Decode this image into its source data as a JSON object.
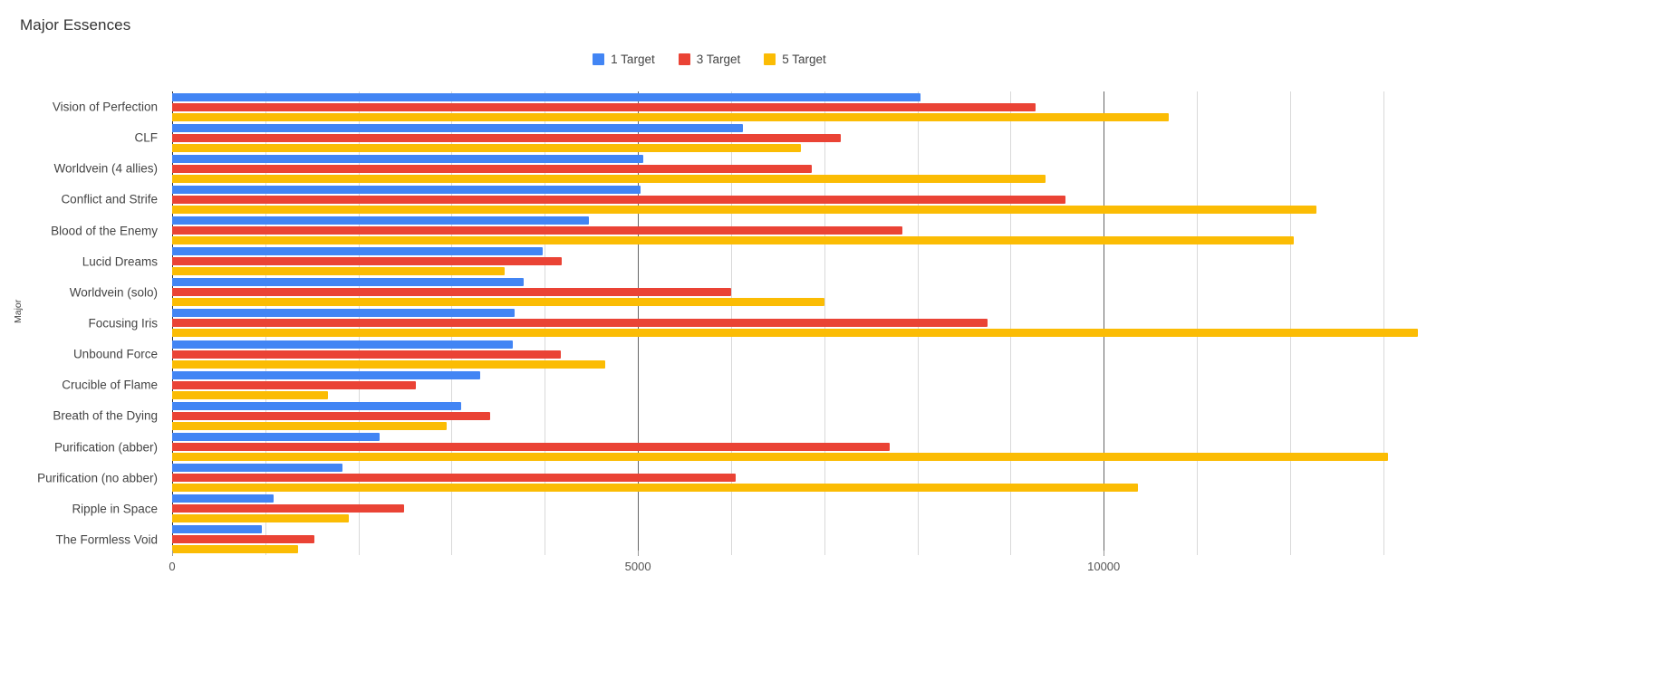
{
  "chart_data": {
    "type": "bar",
    "orientation": "horizontal",
    "title": "Major Essences",
    "xlabel": "",
    "ylabel": "Major",
    "xlim": [
      0,
      13120
    ],
    "xticks": [
      0,
      5000,
      10000
    ],
    "xtick_labels": [
      "0",
      "5000",
      "10000"
    ],
    "grid": true,
    "grid_interval": 1000,
    "legend_position": "top-center",
    "categories": [
      "Vision of Perfection",
      "CLF",
      "Worldvein (4 allies)",
      "Conflict and Strife",
      "Blood of the Enemy",
      "Lucid Dreams",
      "Worldvein (solo)",
      "Focusing Iris",
      "Unbound Force",
      "Crucible of Flame",
      "Breath of the Dying",
      "Purification (abber)",
      "Purification (no abber)",
      "Ripple in Space",
      "The Formless Void"
    ],
    "series": [
      {
        "name": "1 Target",
        "color": "#4285f4",
        "values": [
          8030,
          6130,
          5060,
          5030,
          4470,
          3980,
          3770,
          3680,
          3660,
          3310,
          3100,
          2230,
          1830,
          1090,
          960
        ]
      },
      {
        "name": "3 Target",
        "color": "#ea4335",
        "values": [
          9270,
          7180,
          6870,
          9590,
          7840,
          4180,
          6000,
          8750,
          4170,
          2620,
          3410,
          7700,
          6050,
          2490,
          1530
        ]
      },
      {
        "name": "5 Target",
        "color": "#fbbc04",
        "values": [
          10700,
          6750,
          9380,
          12280,
          12040,
          3570,
          7000,
          13370,
          4650,
          1670,
          2950,
          13050,
          10370,
          1900,
          1350
        ]
      }
    ]
  },
  "legend": {
    "items": [
      {
        "label": "1 Target",
        "color": "#4285f4"
      },
      {
        "label": "3 Target",
        "color": "#ea4335"
      },
      {
        "label": "5 Target",
        "color": "#fbbc04"
      }
    ]
  }
}
